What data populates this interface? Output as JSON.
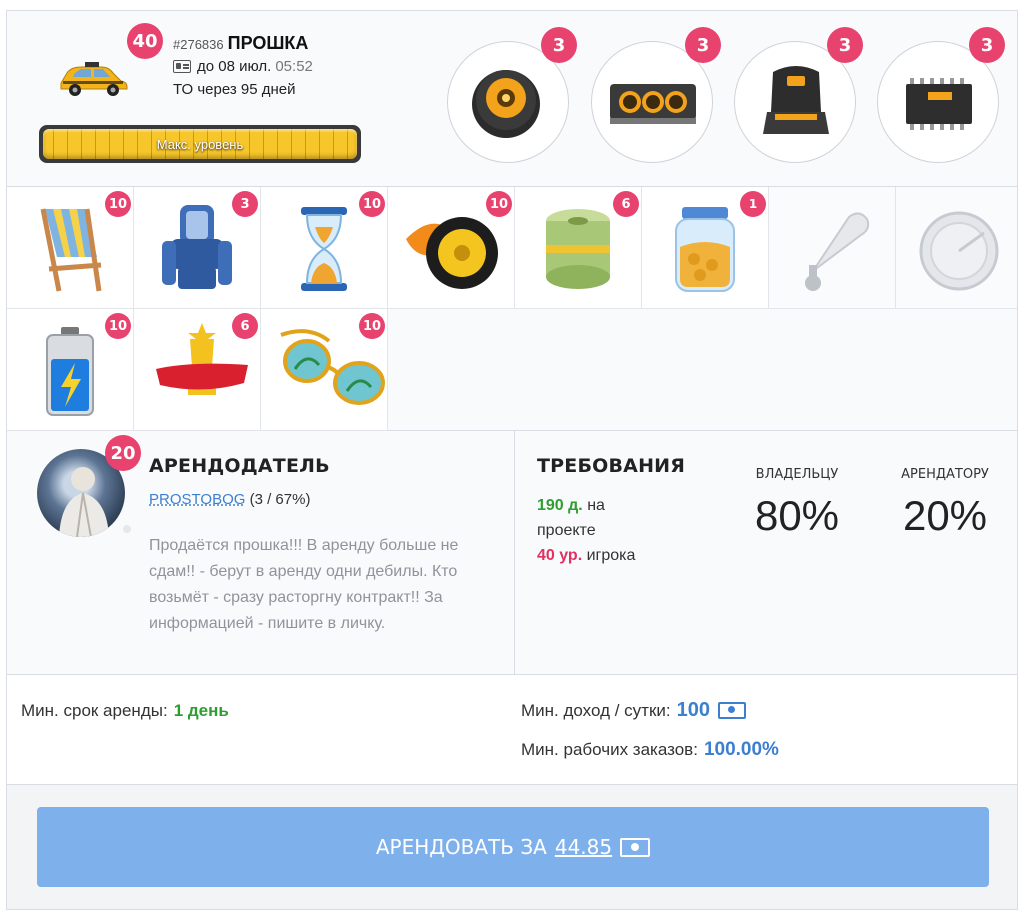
{
  "car": {
    "level": "40",
    "id": "#276836",
    "name": "ПРОШКА",
    "until_label": "до 08 июл.",
    "until_time": "05:52",
    "service_text": "ТО через 95 дней",
    "level_label": "Макс. уровень",
    "level_progress": 1.0
  },
  "parts": [
    {
      "icon": "speaker-icon",
      "count": "3"
    },
    {
      "icon": "gauges-icon",
      "count": "3"
    },
    {
      "icon": "racing-seat-icon",
      "count": "3"
    },
    {
      "icon": "chip-icon",
      "count": "3"
    }
  ],
  "items": [
    {
      "icon": "deck-chair-icon",
      "count": "10"
    },
    {
      "icon": "massage-chair-icon",
      "count": "3"
    },
    {
      "icon": "hourglass-icon",
      "count": "10"
    },
    {
      "icon": "flaming-wheel-icon",
      "count": "10"
    },
    {
      "icon": "money-roll-icon",
      "count": "6"
    },
    {
      "icon": "coin-jar-icon",
      "count": "1"
    },
    {
      "icon": "horn-icon",
      "count": ""
    },
    {
      "icon": "radar-icon",
      "count": ""
    },
    {
      "icon": "battery-icon",
      "count": "10"
    },
    {
      "icon": "trophy-icon",
      "count": "6"
    },
    {
      "icon": "sunglasses-icon",
      "count": "10"
    }
  ],
  "landlord": {
    "title": "АРЕНДОДАТЕЛЬ",
    "level": "20",
    "username": "PROSTOBOG",
    "stats": "(3 / 67%)",
    "description": "Продаётся прошка!!! В аренду больше не сдам!! - берут в аренду одни дебилы. Кто возьмёт - сразу расторгну контракт!! За информацией - пишите в личку."
  },
  "requirements": {
    "title": "ТРЕБОВАНИЯ",
    "days_value": "190 д.",
    "days_text": "на проекте",
    "level_value": "40 ур.",
    "level_text": "игрока"
  },
  "shares": {
    "owner_label": "ВЛАДЕЛЬЦУ",
    "owner_value": "80%",
    "renter_label": "АРЕНДАТОРУ",
    "renter_value": "20%"
  },
  "terms": {
    "min_term_label": "Мин. срок аренды:",
    "min_term_value": "1 день",
    "min_income_label": "Мин. доход / сутки:",
    "min_income_value": "100",
    "min_orders_label": "Мин. рабочих заказов:",
    "min_orders_value": "100.00%"
  },
  "action": {
    "label": "АРЕНДОВАТЬ ЗА",
    "price": "44.85"
  },
  "colors": {
    "badge": "#e8426f",
    "accent_blue": "#3d7fcf",
    "button": "#7eb0ec",
    "green": "#2f9e2f"
  }
}
